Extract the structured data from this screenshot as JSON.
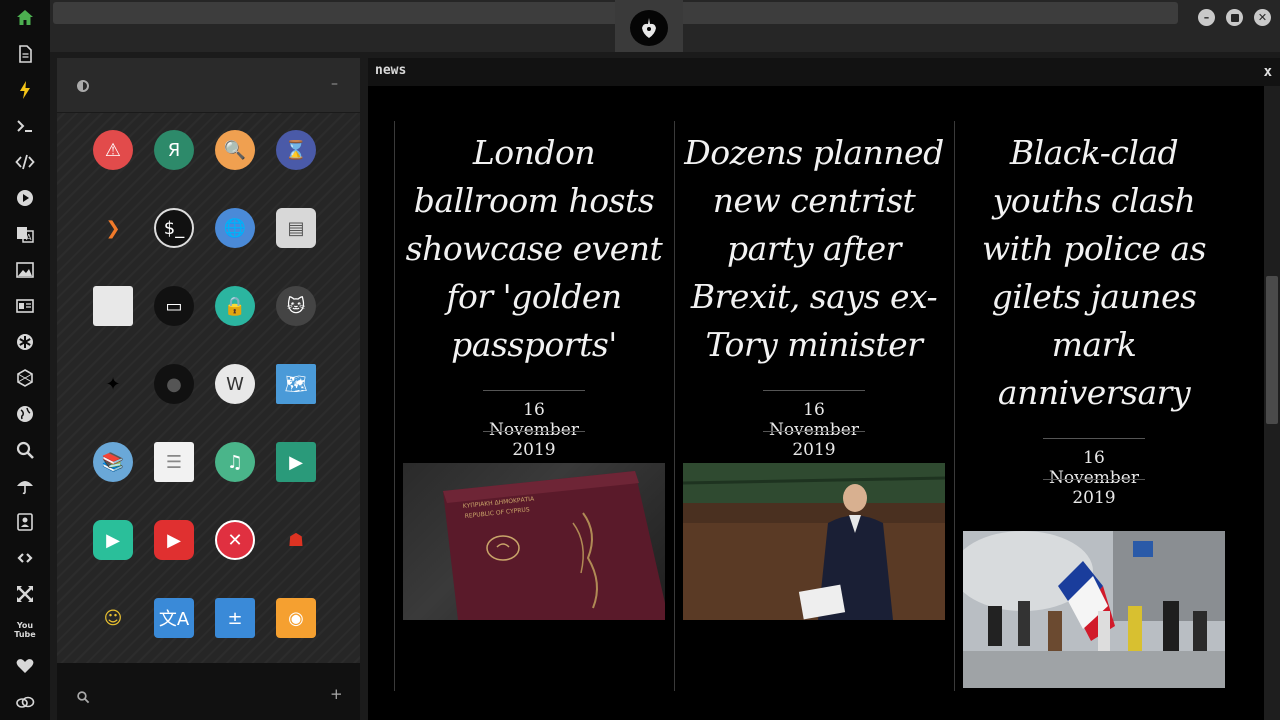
{
  "dock": {
    "icons": [
      "home-icon",
      "document-icon",
      "bolt-icon",
      "terminal-icon",
      "code-icon",
      "play-icon",
      "translate-icon",
      "image-icon",
      "news-icon",
      "star-of-life-icon",
      "hexagon-icon",
      "globe-icon",
      "search-icon",
      "umbrella-icon",
      "contact-icon",
      "link-icon",
      "arrows-icon",
      "youtube-icon",
      "heart-icon",
      "cloud-icon"
    ],
    "youtube_label": "You\nTube"
  },
  "apps_panel": {
    "header_left_icon": "contrast-icon",
    "header_right_icon": "minimize-icon",
    "minimize_symbol": "–",
    "footer_search_icon": "search-icon",
    "footer_add_symbol": "+",
    "apps": [
      {
        "name": "warning-app-icon",
        "glyph": "⚠"
      },
      {
        "name": "yandex-app-icon",
        "glyph": "Я"
      },
      {
        "name": "magnifier-app-icon",
        "glyph": "🔍"
      },
      {
        "name": "hourglass-app-icon",
        "glyph": "⌛"
      },
      {
        "name": "arrow-app-icon",
        "glyph": "❯"
      },
      {
        "name": "terminal-app-icon",
        "glyph": "$_"
      },
      {
        "name": "globe-app-icon",
        "glyph": "🌐"
      },
      {
        "name": "drive-app-icon",
        "glyph": "▤"
      },
      {
        "name": "window-app-icon",
        "glyph": ""
      },
      {
        "name": "chat-app-icon",
        "glyph": "▭"
      },
      {
        "name": "cloud-lock-app-icon",
        "glyph": "🔒"
      },
      {
        "name": "github-app-icon",
        "glyph": "🐱"
      },
      {
        "name": "starfleet-app-icon",
        "glyph": "✦"
      },
      {
        "name": "death-star-app-icon",
        "glyph": "●"
      },
      {
        "name": "wikipedia-app-icon",
        "glyph": "W"
      },
      {
        "name": "map-app-icon",
        "glyph": "🗺"
      },
      {
        "name": "books-app-icon",
        "glyph": "📚"
      },
      {
        "name": "notes-app-icon",
        "glyph": "☰"
      },
      {
        "name": "music-app-icon",
        "glyph": "♫"
      },
      {
        "name": "video-app-icon",
        "glyph": "▶"
      },
      {
        "name": "media-player-app-icon",
        "glyph": "▶"
      },
      {
        "name": "video-recorder-app-icon",
        "glyph": "▶"
      },
      {
        "name": "close-app-icon",
        "glyph": "✕"
      },
      {
        "name": "iron-man-app-icon",
        "glyph": "☗"
      },
      {
        "name": "c3po-app-icon",
        "glyph": "☺"
      },
      {
        "name": "translate-app-icon",
        "glyph": "文A"
      },
      {
        "name": "calculator-app-icon",
        "glyph": "±"
      },
      {
        "name": "camera-app-icon",
        "glyph": "◉"
      }
    ]
  },
  "news": {
    "title": "news",
    "close_label": "x",
    "articles": [
      {
        "headline": "London ballroom hosts showcase event for 'golden passports'",
        "date": "16 November 2019",
        "image_icon": "passport-photo"
      },
      {
        "headline": "Dozens planned new centrist party after Brexit, says ex-Tory minister",
        "date": "16 November 2019",
        "image_icon": "parliament-photo"
      },
      {
        "headline": "Black-clad youths clash with police as gilets jaunes mark anniversary",
        "date": "16 November 2019",
        "image_icon": "protest-photo"
      }
    ]
  },
  "colors": {
    "dock_bg": "#0d0d0d",
    "home_icon": "#4caf50",
    "bolt_icon": "#f5c518",
    "passport": "#5a1a2a",
    "parliament": "#2f4a30",
    "flag_blue": "#1a3d9c",
    "flag_red": "#d11a2a"
  }
}
